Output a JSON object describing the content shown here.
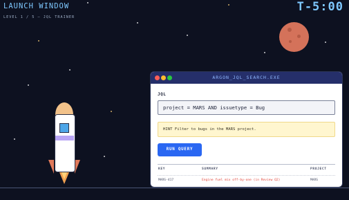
{
  "header": {
    "title": "LAUNCH WINDOW",
    "subtitle": "LEVEL 1 / 5 — JQL TRAINER",
    "timer": "T-5:00"
  },
  "window": {
    "title": "ARGON_JQL_SEARCH.EXE",
    "jql_label": "JQL",
    "jql_value": "project = MARS AND issuetype = Bug",
    "hint": "HINT Filter to bugs in the MARS project.",
    "run_button": "RUN QUERY",
    "results": {
      "columns": [
        "KEY",
        "SUMMARY",
        "PROJECT"
      ],
      "rows": [
        {
          "key": "MARS-417",
          "summary": "Engine fuel mix off-by-one (in Review Q2)",
          "project": "MARS"
        }
      ]
    }
  },
  "colors": {
    "background": "#0d1120",
    "accent": "#7ec8ff",
    "planet": "#d4725a",
    "button": "#2a67f2",
    "error_text": "#e2453a"
  }
}
